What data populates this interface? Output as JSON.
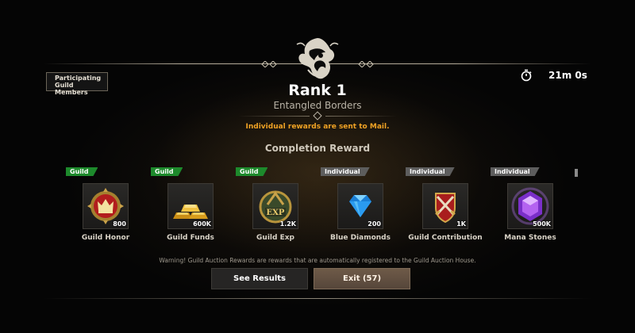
{
  "header": {
    "participants_label": "Participating Guild Members",
    "timer": "21m 0s"
  },
  "rank": {
    "title": "Rank 1",
    "subtitle": "Entangled Borders",
    "mail_note": "Individual rewards are sent to Mail."
  },
  "section_title": "Completion Reward",
  "rewards": [
    {
      "tag": "Guild",
      "tag_type": "guild",
      "name": "Guild Honor",
      "qty": "800",
      "icon": "crown-medal-icon"
    },
    {
      "tag": "Guild",
      "tag_type": "guild",
      "name": "Guild Funds",
      "qty": "600K",
      "icon": "gold-bars-icon"
    },
    {
      "tag": "Guild",
      "tag_type": "guild",
      "name": "Guild Exp",
      "qty": "1.2K",
      "icon": "exp-medal-icon"
    },
    {
      "tag": "Individual",
      "tag_type": "individual",
      "name": "Blue Diamonds",
      "qty": "200",
      "icon": "blue-diamond-icon"
    },
    {
      "tag": "Individual",
      "tag_type": "individual",
      "name": "Guild Contribution",
      "qty": "1K",
      "icon": "crossed-swords-shield-icon"
    },
    {
      "tag": "Individual",
      "tag_type": "individual",
      "name": "Mana Stones",
      "qty": "500K",
      "icon": "mana-stone-icon"
    }
  ],
  "warning": "Warning! Guild Auction Rewards are rewards that are automatically registered to the Guild Auction House.",
  "buttons": {
    "results": "See Results",
    "exit": "Exit (57)"
  },
  "colors": {
    "guild_tag": "#1d8a2c",
    "individual_tag": "#5d5d5d",
    "mail_note": "#f0a224",
    "exit_button": "#6e5a48"
  }
}
